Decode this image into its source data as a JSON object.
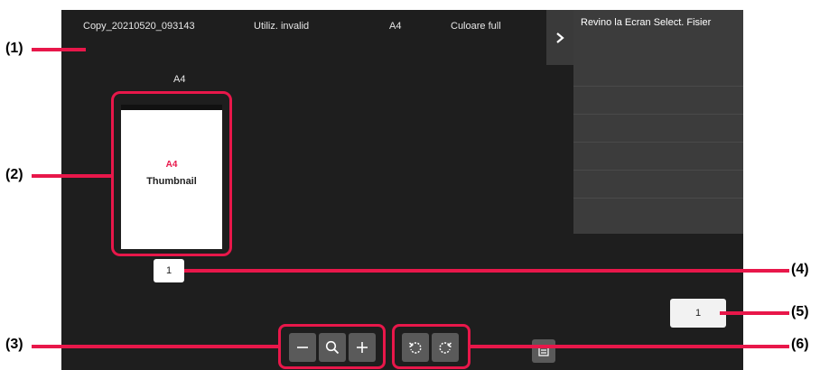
{
  "infobar": {
    "file_name": "Copy_20210520_093143",
    "user": "Utiliz. invalid",
    "paper_size": "A4",
    "color_mode": "Culoare full"
  },
  "side_panel": {
    "toggle_icon": "chevron-right-icon",
    "back_label": "Revino la Ecran Select. Fisier"
  },
  "preview": {
    "size_label": "A4",
    "thumb_size_text": "A4",
    "thumb_text": "Thumbnail",
    "page_number": "1",
    "total_pages": "1"
  },
  "toolbar": {
    "zoom_out_icon": "minus-icon",
    "zoom_icon": "magnifier-icon",
    "zoom_in_icon": "plus-icon",
    "rotate_left_icon": "rotate-left-icon",
    "rotate_right_icon": "rotate-right-icon",
    "menu_icon": "menu-icon"
  },
  "callouts": [
    "(1)",
    "(2)",
    "(3)",
    "(4)",
    "(5)",
    "(6)"
  ],
  "colors": {
    "accent": "#e8174a",
    "screen": "#1e1e1e",
    "panel": "#3c3c3c"
  }
}
